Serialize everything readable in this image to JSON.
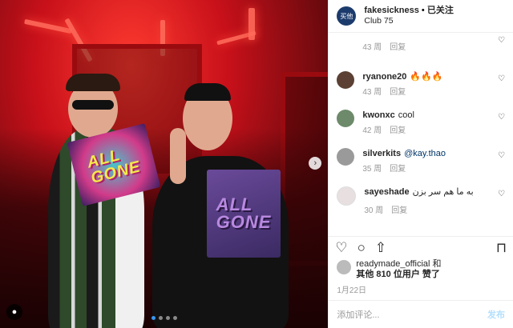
{
  "header": {
    "avatar_text": "买他",
    "username": "fakesickness",
    "separator": " • ",
    "follow_label": "已关注",
    "location": "Club 75"
  },
  "photo": {
    "book_text_1": "ALL\nGONE",
    "book_text_2": "ALL\nGONE",
    "carousel_dot_count": 4,
    "next_icon": "›"
  },
  "comments": [
    {
      "username": "",
      "text": "",
      "time": "43 周",
      "reply": "回复",
      "partial": true
    },
    {
      "username": "ryanone20",
      "text": "🔥🔥🔥",
      "time": "43 周",
      "reply": "回复",
      "avatar_color": "#5c4033"
    },
    {
      "username": "kwonxc",
      "text": "cool",
      "time": "42 周",
      "reply": "回复",
      "avatar_color": "#6d8a6a"
    },
    {
      "username": "silverkits",
      "text": "@kay.thao",
      "time": "35 周",
      "reply": "回复",
      "avatar_color": "#9a9a9a"
    },
    {
      "username": "sayeshade",
      "text": "به ما هم سر بزن",
      "time": "30 周",
      "reply": "回复",
      "avatar_color": "#e8e0e0"
    }
  ],
  "likes": {
    "user": "readymade_official",
    "and": " 和",
    "others": "其他 810 位用户",
    "liked": " 赞了"
  },
  "date": "1月22日",
  "add_comment": {
    "placeholder": "添加评论...",
    "post_label": "发布"
  },
  "icons": {
    "heart": "♡",
    "comment": "○",
    "share": "⇧",
    "save": "⊓",
    "small_heart": "♡"
  }
}
